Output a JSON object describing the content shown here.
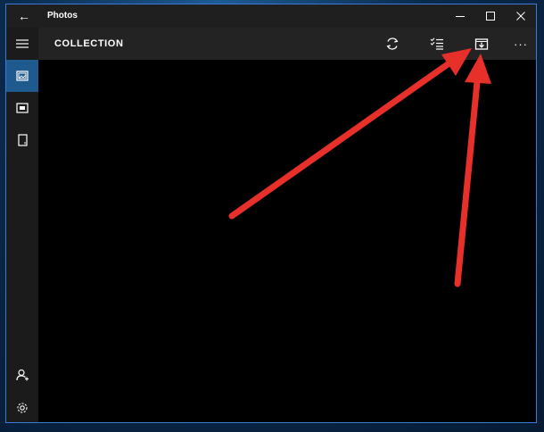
{
  "window": {
    "title": "Photos",
    "back_glyph": "←"
  },
  "toolbar": {
    "heading": "COLLECTION",
    "more_glyph": "···",
    "icons": [
      "refresh-icon",
      "select-icon",
      "import-icon",
      "more-icon"
    ]
  },
  "sidebar": {
    "icons": [
      "hamburger-menu-icon",
      "collection-icon",
      "albums-icon",
      "folders-icon",
      "account-icon",
      "settings-icon"
    ],
    "selected": "collection"
  },
  "colors": {
    "titlebar": "#1f1f1f",
    "toolbar": "#232323",
    "sidebar": "#1b1b1b",
    "selected_accent": "#1f5a8f",
    "content": "#000000",
    "annotation_arrow": "#e8302a"
  }
}
